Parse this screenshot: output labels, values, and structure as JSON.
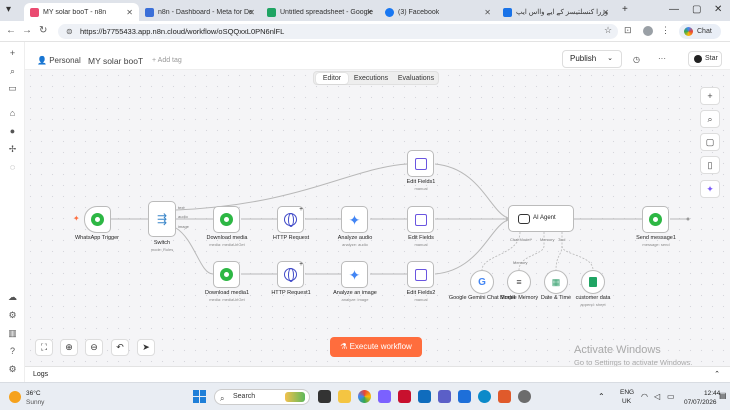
{
  "browser": {
    "tabs": [
      {
        "title": "MY solar booT - n8n",
        "active": true,
        "color": "#ea4b71"
      },
      {
        "title": "n8n - Dashboard - Meta for De",
        "active": false,
        "color": "#3b6fd8"
      },
      {
        "title": "Untitled spreadsheet - Google",
        "active": false,
        "color": "#1fa463"
      },
      {
        "title": "(3) Facebook",
        "active": false,
        "color": "#1877f2"
      },
      {
        "title": "وزرا كنسلتيسز كے ايے وااس ايپ",
        "active": false,
        "color": "#1a73e8"
      }
    ],
    "url": "https://b7755433.app.n8n.cloud/workflow/oSQQxxL0PN6nlFL",
    "chat_label": "Chat"
  },
  "header": {
    "workspace": "Personal",
    "workflow_name": "MY solar booT",
    "add_tag": "+ Add tag",
    "publish_label": "Publish",
    "star_label": "Star"
  },
  "mode_tabs": [
    "Editor",
    "Executions",
    "Evaluations"
  ],
  "nodes": {
    "trigger": {
      "label": "WhatsApp Trigger"
    },
    "switch": {
      "label": "Switch",
      "sub": "mode: Rules",
      "outputs": [
        "text",
        "audio",
        "image"
      ]
    },
    "download1": {
      "label": "Download media",
      "sub": "media: mediaUrlGet"
    },
    "http1": {
      "label": "HTTP Request"
    },
    "audio": {
      "label": "Analyze audio",
      "sub": "analyze: audio"
    },
    "edit_top": {
      "label": "Edit Fields1",
      "sub": "manual"
    },
    "edit_mid": {
      "label": "Edit Fields",
      "sub": "manual"
    },
    "download2": {
      "label": "Download media1",
      "sub": "media: mediaUrlGet"
    },
    "http2": {
      "label": "HTTP Request1"
    },
    "image": {
      "label": "Analyze an image",
      "sub": "analyze: image"
    },
    "edit_bot": {
      "label": "Edit Fields2",
      "sub": "manual"
    },
    "agent": {
      "label": "AI Agent",
      "ports": [
        "Chat Model*",
        "Memory",
        "Tool"
      ]
    },
    "send": {
      "label": "Send message1",
      "sub": "message: send"
    },
    "gemini": {
      "label": "Google Gemini Chat Model"
    },
    "memory": {
      "label": "Simple Memory",
      "port": "Memory"
    },
    "datetime": {
      "label": "Date & Time"
    },
    "customer": {
      "label": "customer data",
      "sub": "append: sheet"
    }
  },
  "execute_label": "Execute workflow",
  "logs_label": "Logs",
  "watermark": {
    "title": "Activate Windows",
    "subtitle": "Go to Settings to activate Windows."
  },
  "taskbar": {
    "temperature": "36°C",
    "condition": "Sunny",
    "search_placeholder": "Search",
    "language": "ENG",
    "region": "UK",
    "time": "12:44",
    "date": "07/07/2026"
  }
}
